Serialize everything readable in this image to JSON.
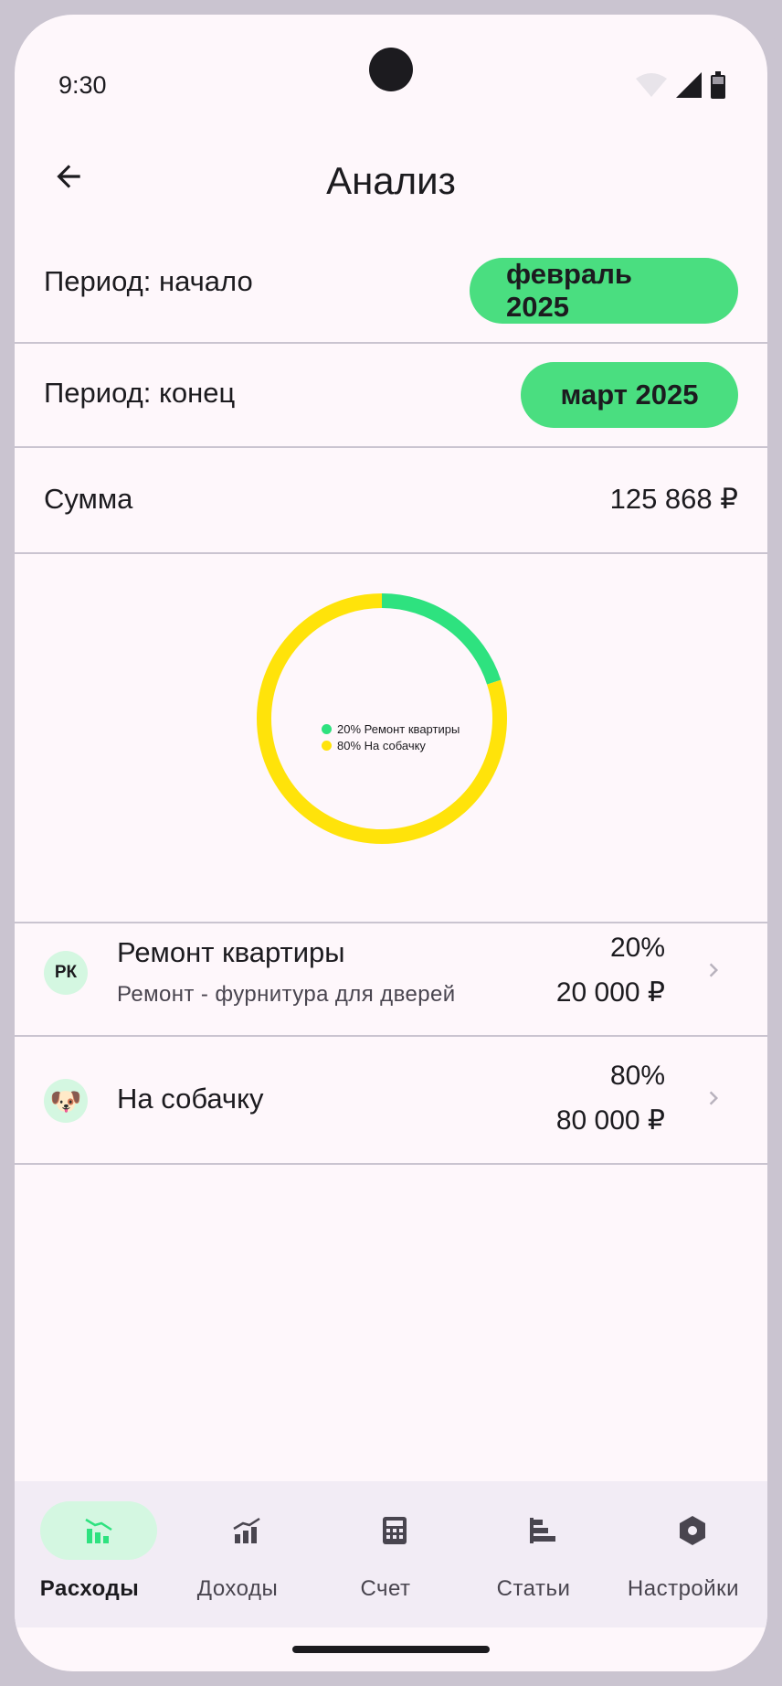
{
  "status": {
    "time": "9:30"
  },
  "header": {
    "title": "Анализ"
  },
  "period_start": {
    "label": "Период: начало",
    "value": "февраль 2025"
  },
  "period_end": {
    "label": "Период: конец",
    "value": "март 2025"
  },
  "sum": {
    "label": "Сумма",
    "value": "125 868 ₽"
  },
  "chart_data": {
    "type": "pie",
    "categories": [
      "Ремонт квартиры",
      "На собачку"
    ],
    "values": [
      20,
      80
    ],
    "legend": [
      "20% Ремонт квартиры",
      "80% На собачку"
    ],
    "colors": [
      "#2ee27f",
      "#ffe30a"
    ]
  },
  "items": [
    {
      "avatar": "РК",
      "title": "Ремонт квартиры",
      "subtitle": "Ремонт - фурнитура для дверей",
      "percent": "20%",
      "amount": "20 000 ₽"
    },
    {
      "avatar": "🐶",
      "title": "На собачку",
      "subtitle": "",
      "percent": "80%",
      "amount": "80 000 ₽"
    }
  ],
  "nav": [
    {
      "label": "Расходы",
      "icon": "expenses-chart-icon",
      "active": true
    },
    {
      "label": "Доходы",
      "icon": "income-chart-icon",
      "active": false
    },
    {
      "label": "Счет",
      "icon": "calculator-icon",
      "active": false
    },
    {
      "label": "Статьи",
      "icon": "articles-icon",
      "active": false
    },
    {
      "label": "Настройки",
      "icon": "settings-icon",
      "active": false
    }
  ],
  "colors": {
    "accent": "#4ade80",
    "active_pill": "#d4f7e1",
    "background": "#fef7fb"
  }
}
